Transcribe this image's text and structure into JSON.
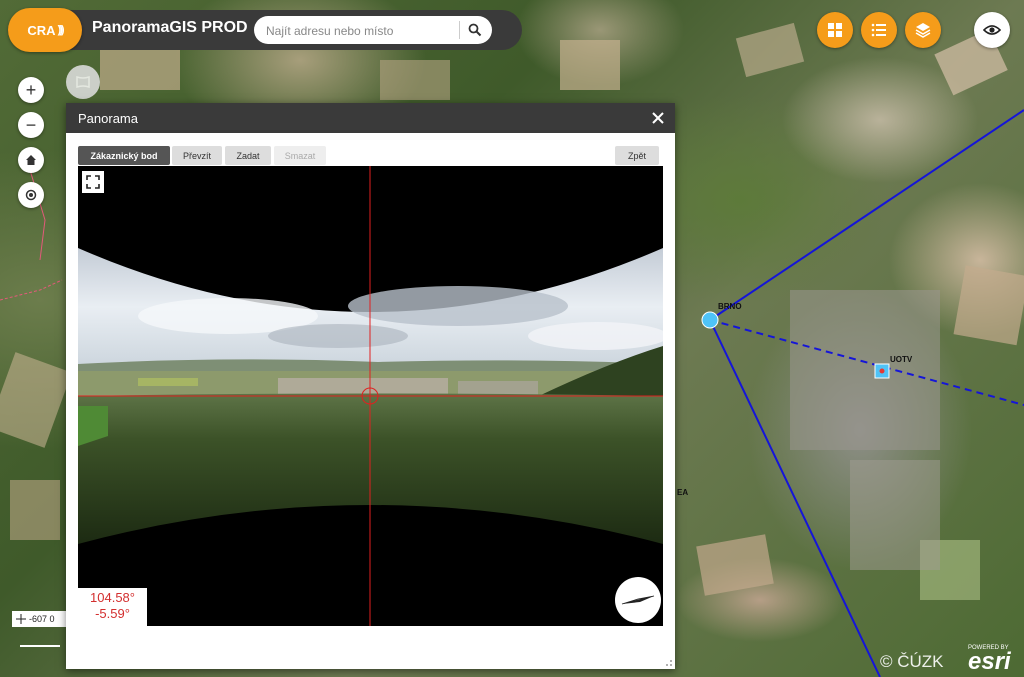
{
  "header": {
    "logo_text": "CRA",
    "app_title": "PanoramaGIS PROD",
    "search_placeholder": "Najít adresu nebo místo"
  },
  "toolbar": {
    "items": [
      {
        "icon": "grid-icon"
      },
      {
        "icon": "list-icon"
      },
      {
        "icon": "layers-icon"
      },
      {
        "icon": "eye-icon"
      }
    ],
    "accent": "#f59c1a"
  },
  "map_controls": {
    "zoom_in": "+",
    "zoom_out": "−"
  },
  "panel": {
    "title": "Panorama",
    "buttons": {
      "customer_point": "Zákaznický bod",
      "take_over": "Převzít",
      "enter": "Zadat",
      "delete": "Smazat",
      "back": "Zpět"
    },
    "angles": {
      "horizontal": "104.58°",
      "vertical": "-5.59°"
    }
  },
  "map": {
    "labels": {
      "point_a": "BRNO",
      "point_b": "UOTV",
      "point_c": "EA"
    },
    "scale_text": "-607 0",
    "copyright": "© ČÚZK",
    "esri_powered": "POWERED BY",
    "esri_brand": "esri"
  }
}
